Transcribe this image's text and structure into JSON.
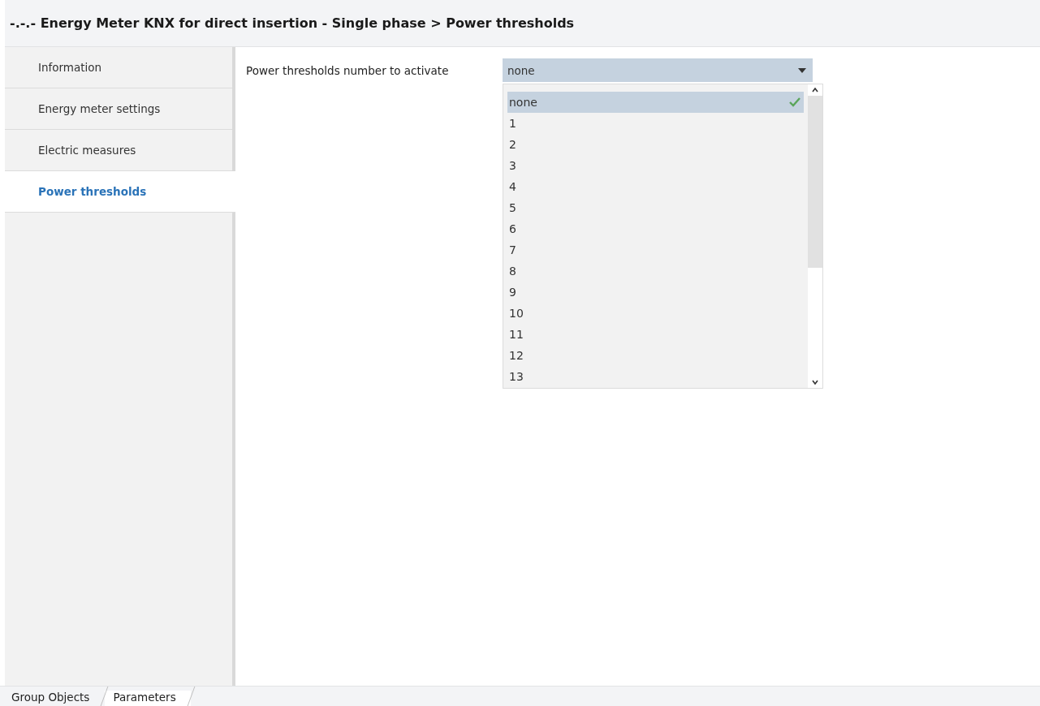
{
  "header": {
    "title": "-.-.- Energy Meter KNX for direct insertion - Single phase > Power thresholds"
  },
  "sidebar": {
    "items": [
      {
        "label": "Information",
        "selected": false
      },
      {
        "label": "Energy meter settings",
        "selected": false
      },
      {
        "label": "Electric measures",
        "selected": false
      },
      {
        "label": "Power thresholds",
        "selected": true
      }
    ]
  },
  "parameter": {
    "label": "Power thresholds number to activate",
    "value": "none",
    "expanded": true,
    "options": [
      {
        "label": "none",
        "selected": true
      },
      {
        "label": "1",
        "selected": false
      },
      {
        "label": "2",
        "selected": false
      },
      {
        "label": "3",
        "selected": false
      },
      {
        "label": "4",
        "selected": false
      },
      {
        "label": "5",
        "selected": false
      },
      {
        "label": "6",
        "selected": false
      },
      {
        "label": "7",
        "selected": false
      },
      {
        "label": "8",
        "selected": false
      },
      {
        "label": "9",
        "selected": false
      },
      {
        "label": "10",
        "selected": false
      },
      {
        "label": "11",
        "selected": false
      },
      {
        "label": "12",
        "selected": false
      },
      {
        "label": "13",
        "selected": false
      }
    ]
  },
  "bottom_tabs": [
    {
      "label": "Group Objects",
      "selected": false
    },
    {
      "label": "Parameters",
      "selected": true
    }
  ]
}
